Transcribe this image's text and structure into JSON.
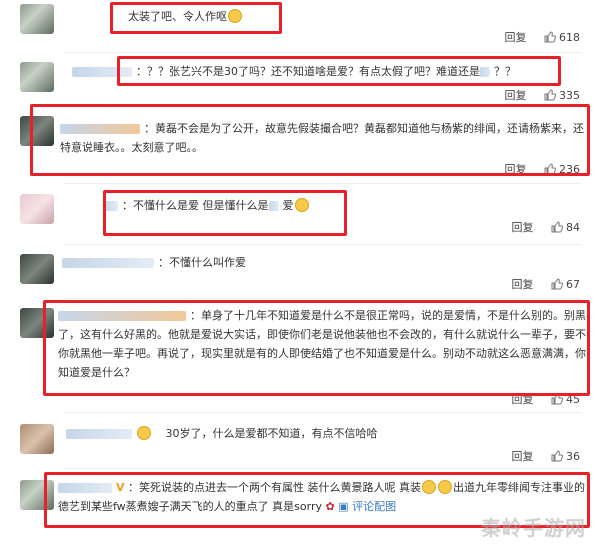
{
  "comments": [
    {
      "text": "太装了吧、令人作呕",
      "reply": "回复",
      "likes": "618"
    },
    {
      "text": "：？？张艺兴不是30了吗？还不知道啥是爱？有点太假了吧？难道还是",
      "text_after": "？？",
      "reply": "回复",
      "likes": "335"
    },
    {
      "text": "：黄磊不会是为了公开，故意先假装撮合吧？黄磊都知道他与杨紫的绯闻，还请杨紫来，还特意说睡衣。。太刻意了吧。。",
      "reply": "回复",
      "likes": "236"
    },
    {
      "text": "：不懂什么是爱 但是懂什么是",
      "text_after": "爱",
      "reply": "回复",
      "likes": "84"
    },
    {
      "text": "：不懂什么叫作爱",
      "reply": "回复",
      "likes": "67"
    },
    {
      "text": "：单身了十几年不知道爱是什么不是很正常吗，说的是爱情，不是什么别的。别黑了，这有什么好黑的。他就是爱说大实话，即使你们老是说他装他也不会改的，有什么就说什么一辈子，要不你就黑他一辈子吧。再说了，现实里就是有的人即使结婚了也不知道爱是什么。别动不动就这么恶意满满，你知道爱是什么？",
      "reply": "回复",
      "likes": "45"
    },
    {
      "text": "30岁了，什么是爱都不知道，有点不信哈哈",
      "reply": "回复",
      "likes": "36"
    },
    {
      "text": "：笑死说装的点进去一个两个有属性 装什么黄景路人呢 真装",
      "text_mid": "出道九年零绯闻专注事业的德艺到某些fw蒸煮嫂子满天飞的人的重点了 真是sorry",
      "link": "评论配图"
    }
  ],
  "watermark": "秦岭手游网"
}
